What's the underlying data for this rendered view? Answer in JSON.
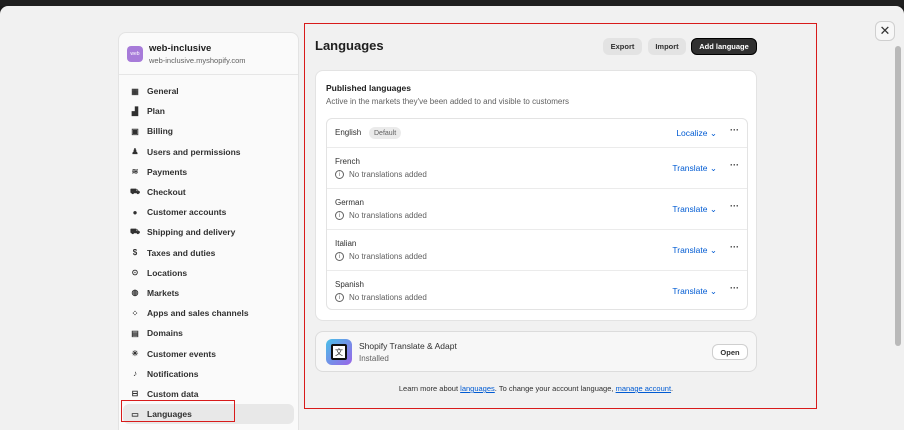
{
  "window": {
    "close_icon": "close-icon"
  },
  "sidebar": {
    "store_avatar": "web",
    "store_name": "web-inclusive",
    "store_url": "web-inclusive.myshopify.com",
    "items": [
      {
        "label": "General",
        "icon": "store-icon"
      },
      {
        "label": "Plan",
        "icon": "plan-icon"
      },
      {
        "label": "Billing",
        "icon": "billing-icon"
      },
      {
        "label": "Users and permissions",
        "icon": "users-icon"
      },
      {
        "label": "Payments",
        "icon": "payments-icon"
      },
      {
        "label": "Checkout",
        "icon": "cart-icon"
      },
      {
        "label": "Customer accounts",
        "icon": "person-icon"
      },
      {
        "label": "Shipping and delivery",
        "icon": "truck-icon"
      },
      {
        "label": "Taxes and duties",
        "icon": "tax-icon"
      },
      {
        "label": "Locations",
        "icon": "location-icon"
      },
      {
        "label": "Markets",
        "icon": "globe-icon"
      },
      {
        "label": "Apps and sales channels",
        "icon": "apps-icon"
      },
      {
        "label": "Domains",
        "icon": "domain-icon"
      },
      {
        "label": "Customer events",
        "icon": "events-icon"
      },
      {
        "label": "Notifications",
        "icon": "bell-icon"
      },
      {
        "label": "Custom data",
        "icon": "data-icon"
      },
      {
        "label": "Languages",
        "icon": "language-icon",
        "active": true
      }
    ]
  },
  "header": {
    "title": "Languages",
    "export_label": "Export",
    "import_label": "Import",
    "add_label": "Add language"
  },
  "published": {
    "title": "Published languages",
    "subtitle": "Active in the markets they've been added to and visible to customers",
    "languages": [
      {
        "name": "English",
        "badge": "Default",
        "action": "Localize"
      },
      {
        "name": "French",
        "status": "No translations added",
        "action": "Translate"
      },
      {
        "name": "German",
        "status": "No translations added",
        "action": "Translate"
      },
      {
        "name": "Italian",
        "status": "No translations added",
        "action": "Translate"
      },
      {
        "name": "Spanish",
        "status": "No translations added",
        "action": "Translate"
      }
    ]
  },
  "app": {
    "name": "Shopify Translate & Adapt",
    "status": "Installed",
    "open_label": "Open"
  },
  "footer": {
    "prefix": "Learn more about ",
    "link1": "languages",
    "middle": ". To change your account language, ",
    "link2": "manage account",
    "suffix": "."
  },
  "colors": {
    "highlight": "#d81b1b",
    "link": "#005bd3",
    "primary_button": "#303030"
  }
}
